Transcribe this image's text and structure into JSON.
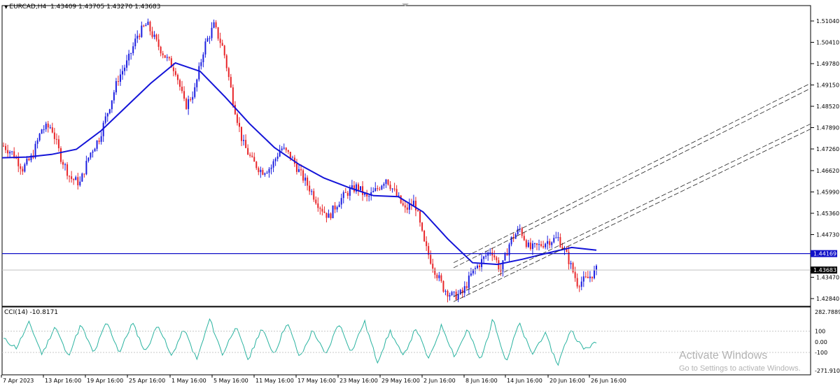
{
  "header": {
    "symbol_tf": "EURCAD,H4",
    "ohlc": "1.43409 1.43705 1.43270 1.43683"
  },
  "indicator": {
    "label": "CCI(14) -10.8171"
  },
  "price_axis": {
    "ticks": [
      "1.51040",
      "1.50410",
      "1.49780",
      "1.49150",
      "1.48520",
      "1.47890",
      "1.47260",
      "1.46620",
      "1.45990",
      "1.45360",
      "1.44730",
      "1.43470",
      "1.42840"
    ],
    "hline_label": "1.44169",
    "current_label": "1.43683",
    "range": [
      1.425,
      1.514
    ]
  },
  "cci_axis": {
    "ticks": [
      "282.7889",
      "100",
      "0.00",
      "-100",
      "-271.9101"
    ]
  },
  "time_axis": {
    "labels": [
      "7 Apr 2023",
      "13 Apr 16:00",
      "19 Apr 16:00",
      "25 Apr 16:00",
      "1 May 16:00",
      "5 May 16:00",
      "11 May 16:00",
      "17 May 16:00",
      "23 May 16:00",
      "29 May 16:00",
      "2 Jun 16:00",
      "8 Jun 16:00",
      "14 Jun 16:00",
      "20 Jun 16:00",
      "26 Jun 16:00"
    ]
  },
  "watermark": {
    "line1": "Activate Windows",
    "line2": "Go to Settings to activate Windows."
  },
  "colors": {
    "bull": "#1b1ee0",
    "bear": "#e8262a",
    "ma": "#1414d8",
    "hline": "#1010c8",
    "cci": "#2ab3a0"
  },
  "chart_data": {
    "type": "line",
    "title": "EURCAD,H4",
    "series": [
      {
        "name": "EURCAD",
        "values": [
          1.4735,
          1.4712,
          1.4668,
          1.4703,
          1.4785,
          1.4792,
          1.4701,
          1.464,
          1.4625,
          1.471,
          1.4758,
          1.4845,
          1.4935,
          1.4985,
          1.5062,
          1.5095,
          1.504,
          1.4995,
          1.4958,
          1.485,
          1.49,
          1.503,
          1.509,
          1.502,
          1.487,
          1.4745,
          1.469,
          1.466,
          1.4672,
          1.473,
          1.4705,
          1.4655,
          1.461,
          1.456,
          1.4525,
          1.457,
          1.4598,
          1.4615,
          1.458,
          1.4605,
          1.464,
          1.4593,
          1.4545,
          1.457,
          1.4445,
          1.4375,
          1.4315,
          1.429,
          1.43,
          1.436,
          1.4395,
          1.443,
          1.4365,
          1.4455,
          1.449,
          1.443,
          1.444,
          1.4455,
          1.4462,
          1.4405,
          1.433,
          1.4341,
          1.4368
        ]
      },
      {
        "name": "",
        "values": [
          1.47,
          1.4702,
          1.471,
          1.4725,
          1.478,
          1.485,
          1.492,
          1.498,
          1.4955,
          1.488,
          1.48,
          1.473,
          1.468,
          1.464,
          1.4612,
          1.4588,
          1.4585,
          1.454,
          1.446,
          1.439,
          1.4385,
          1.44,
          1.4418,
          1.4435,
          1.4427
        ]
      }
    ],
    "cci_values": [
      28,
      -56,
      182,
      -120,
      150,
      -140,
      162,
      -114,
      190,
      -104,
      182,
      -98,
      168,
      -141,
      120,
      -171,
      216,
      -123,
      149,
      -175,
      131,
      -118,
      190,
      -154,
      115,
      -134,
      182,
      -98,
      196,
      -191,
      103,
      -142,
      131,
      -170,
      159,
      -140,
      121,
      -186,
      223,
      -194,
      178,
      -123,
      84,
      -218,
      120,
      -70,
      -10.8171
    ],
    "levels": {
      "hline": 1.44169,
      "current": 1.43683
    }
  }
}
